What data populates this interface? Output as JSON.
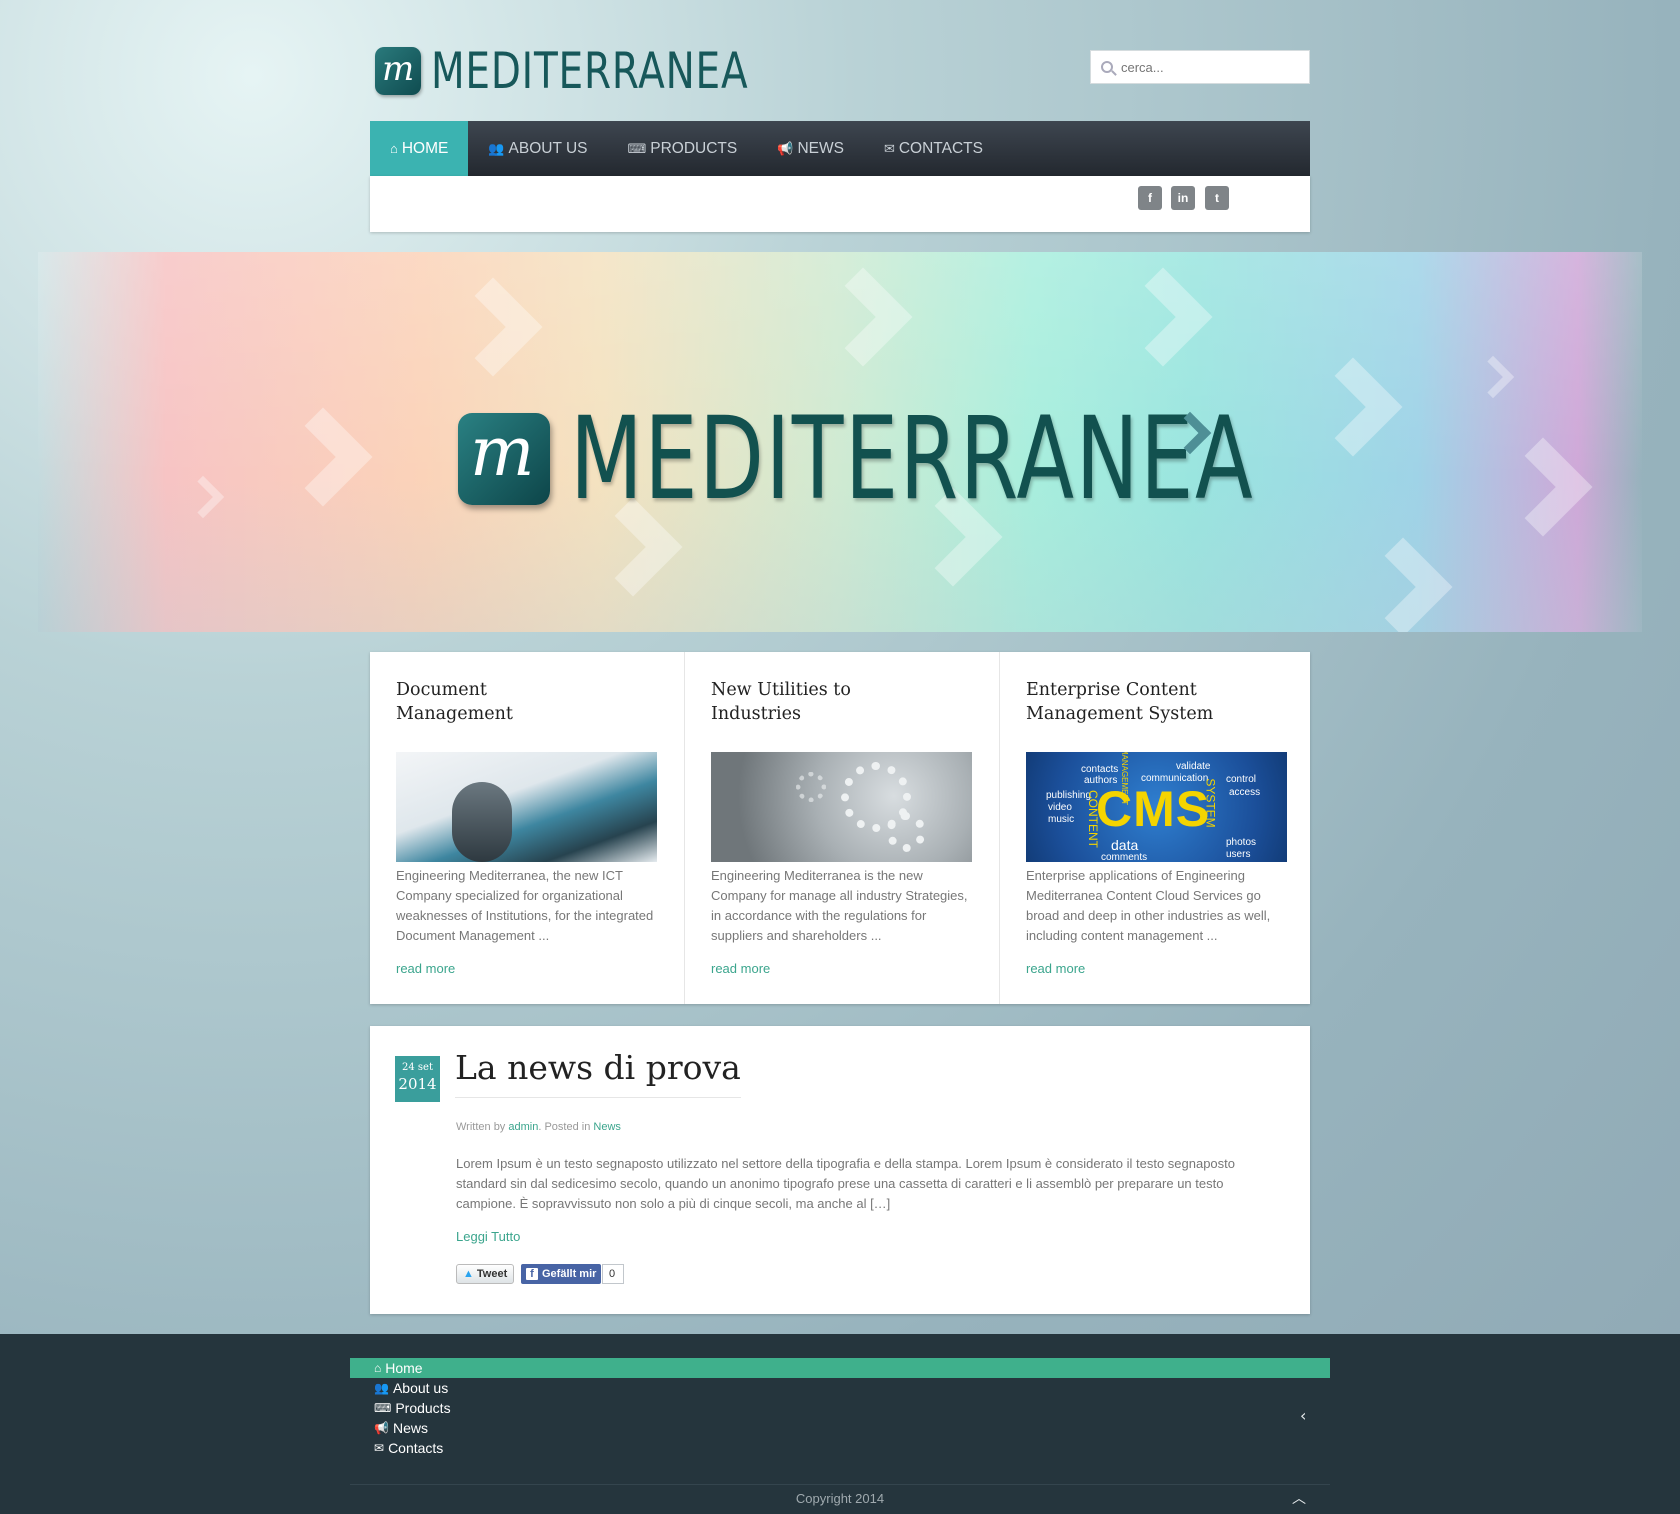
{
  "brand": {
    "name": "MEDITERRANEA",
    "mark": "m"
  },
  "search": {
    "placeholder": "cerca..."
  },
  "nav": [
    {
      "label": "HOME",
      "icon": "home-icon",
      "glyph": "⌂",
      "active": true
    },
    {
      "label": "ABOUT US",
      "icon": "users-icon",
      "glyph": "👥",
      "active": false
    },
    {
      "label": "PRODUCTS",
      "icon": "keyboard-icon",
      "glyph": "⌨",
      "active": false
    },
    {
      "label": "NEWS",
      "icon": "megaphone-icon",
      "glyph": "📢",
      "active": false
    },
    {
      "label": "CONTACTS",
      "icon": "envelope-icon",
      "glyph": "✉",
      "active": false
    }
  ],
  "social": [
    {
      "name": "facebook-icon",
      "glyph": "f"
    },
    {
      "name": "linkedin-icon",
      "glyph": "in"
    },
    {
      "name": "twitter-icon",
      "glyph": "t"
    }
  ],
  "banner": {
    "text": "MEDITERRANEA",
    "mark": "m"
  },
  "features": [
    {
      "title": "Document Management",
      "text": "Engineering Mediterranea, the new ICT Company specialized for organizational weaknesses of Institutions, for the integrated Document Management ...",
      "link": "read more"
    },
    {
      "title": "New Utilities to Industries",
      "text": "Engineering Mediterranea is the new Company for manage all industry Strategies, in accordance with the regulations for suppliers and shareholders ...",
      "link": "read more"
    },
    {
      "title": "Enterprise Content Management System",
      "text": "Enterprise applications of Engineering Mediterranea Content Cloud Services go broad and deep in other industries as well, including content management ...",
      "link": "read more",
      "image_words": [
        "contacts",
        "authors",
        "validate",
        "communication",
        "control",
        "access",
        "publishing",
        "video",
        "music",
        "CMS",
        "data",
        "comments",
        "photos",
        "users",
        "SYSTEM",
        "CONTENT",
        "MANAGEMENT"
      ]
    }
  ],
  "news": {
    "day": "24 set",
    "year": "2014",
    "title": "La news di prova",
    "meta_prefix": "Written by",
    "author": "admin",
    "meta_mid": ". Posted in",
    "category": "News",
    "body": "Lorem Ipsum è un testo segnaposto utilizzato nel settore della tipografia e della stampa. Lorem Ipsum è considerato il testo segnaposto standard sin dal sedicesimo secolo, quando un anonimo tipografo prese una cassetta di caratteri e li assemblò per preparare un testo campione. È sopravvissuto non solo a più di cinque secoli, ma anche al […]",
    "read_link": "Leggi Tutto",
    "tweet": "Tweet",
    "like": "Gefällt mir",
    "like_count": "0"
  },
  "footer": {
    "nav": [
      {
        "label": "Home",
        "icon": "home-icon",
        "glyph": "⌂",
        "active": true
      },
      {
        "label": "About us",
        "icon": "users-icon",
        "glyph": "👥",
        "active": false
      },
      {
        "label": "Products",
        "icon": "keyboard-icon",
        "glyph": "⌨",
        "active": false
      },
      {
        "label": "News",
        "icon": "megaphone-icon",
        "glyph": "📢",
        "active": false
      },
      {
        "label": "Contacts",
        "icon": "envelope-icon",
        "glyph": "✉",
        "active": false
      }
    ],
    "copyright": "Copyright 2014"
  },
  "colors": {
    "accent": "#3bb3b1",
    "footer_active": "#3fb08c",
    "link": "#3ba58d",
    "nav_bg": "#2b3139",
    "footer_bg": "#25353d"
  }
}
